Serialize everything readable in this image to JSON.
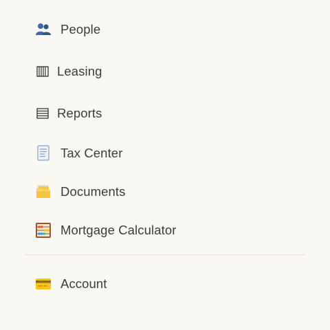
{
  "menu": {
    "items": [
      {
        "label": "People",
        "icon": "people-icon"
      },
      {
        "label": "Leasing",
        "icon": "leasing-icon"
      },
      {
        "label": "Reports",
        "icon": "reports-icon"
      },
      {
        "label": "Tax Center",
        "icon": "receipt-icon"
      },
      {
        "label": "Documents",
        "icon": "folder-icon"
      },
      {
        "label": "Mortgage Calculator",
        "icon": "abacus-icon"
      }
    ],
    "account": {
      "label": "Account",
      "icon": "credit-card-icon"
    }
  },
  "colors": {
    "background": "#faf8f2",
    "text": "#3c3c3c",
    "divider": "#efd7d7"
  }
}
